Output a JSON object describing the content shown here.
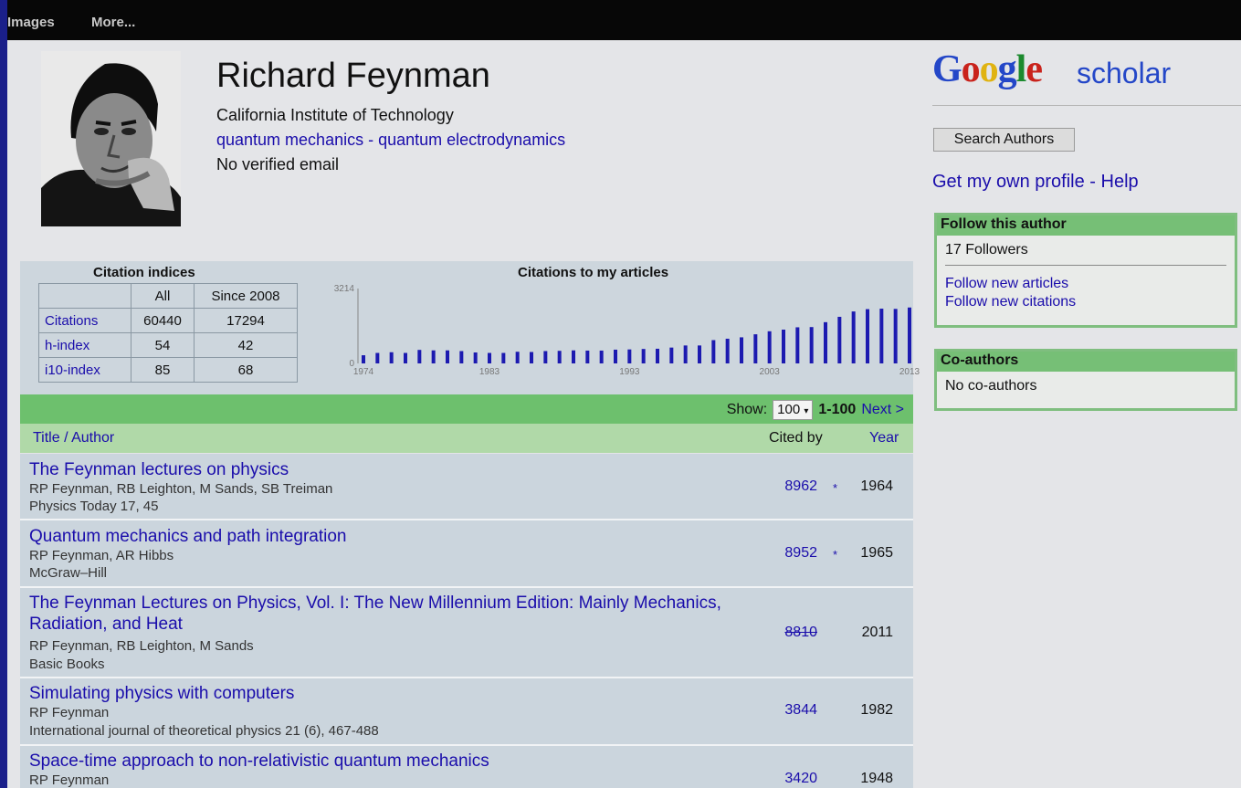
{
  "nav": {
    "images": "Images",
    "more": "More..."
  },
  "profile": {
    "name": "Richard Feynman",
    "institution": "California Institute of Technology",
    "topics": "quantum mechanics - quantum electrodynamics",
    "email": "No verified email"
  },
  "brand": {
    "google": [
      "G",
      "o",
      "o",
      "g",
      "l",
      "e"
    ],
    "scholar": "scholar",
    "colors": [
      "#2447c8",
      "#c9231c",
      "#e0b311",
      "#2447c8",
      "#1c8a2e",
      "#c9231c"
    ]
  },
  "sidebar": {
    "search_button": "Search Authors",
    "profile_link": "Get my own profile - Help",
    "follow_title": "Follow this author",
    "followers": "17 Followers",
    "follow_articles": "Follow new articles",
    "follow_citations": "Follow new citations",
    "coauthors_title": "Co-authors",
    "coauthors_text": "No co-authors"
  },
  "citation_indices": {
    "title": "Citation indices",
    "headers": [
      "",
      "All",
      "Since 2008"
    ],
    "rows": [
      {
        "label": "Citations",
        "all": "60440",
        "since": "17294"
      },
      {
        "label": "h-index",
        "all": "54",
        "since": "42"
      },
      {
        "label": "i10-index",
        "all": "85",
        "since": "68"
      }
    ]
  },
  "chart_data": {
    "type": "bar",
    "title": "Citations to my articles",
    "xlabel": "",
    "ylabel": "",
    "ylim": [
      0,
      3214
    ],
    "y_ticks": [
      "0",
      "3214"
    ],
    "x_ticks": [
      "1974",
      "1983",
      "1993",
      "2003",
      "2013"
    ],
    "color": "#1c1ab0",
    "categories": [
      1974,
      1975,
      1976,
      1977,
      1978,
      1979,
      1980,
      1981,
      1982,
      1983,
      1984,
      1985,
      1986,
      1987,
      1988,
      1989,
      1990,
      1991,
      1992,
      1993,
      1994,
      1995,
      1996,
      1997,
      1998,
      1999,
      2000,
      2001,
      2002,
      2003,
      2004,
      2005,
      2006,
      2007,
      2008,
      2009,
      2010,
      2011,
      2012,
      2013
    ],
    "values": [
      350,
      450,
      480,
      450,
      580,
      560,
      560,
      530,
      470,
      450,
      450,
      500,
      490,
      530,
      540,
      560,
      550,
      550,
      590,
      600,
      620,
      630,
      680,
      770,
      770,
      1000,
      1060,
      1120,
      1250,
      1380,
      1450,
      1550,
      1560,
      1770,
      2000,
      2230,
      2330,
      2350,
      2340,
      2400
    ]
  },
  "articles_bar": {
    "show_label": "Show:",
    "per_page": "100",
    "range": "1-100",
    "next": "Next >"
  },
  "columns": {
    "title": "Title / Author",
    "cited": "Cited by",
    "year": "Year"
  },
  "articles": [
    {
      "title": "The Feynman lectures on physics",
      "authors": "RP Feynman, RB Leighton, M Sands, SB Treiman",
      "venue": "Physics Today 17, 45",
      "cited": "8962",
      "star": "*",
      "year": "1964"
    },
    {
      "title": "Quantum mechanics and path integration",
      "authors": "RP Feynman, AR Hibbs",
      "venue": "McGraw–Hill",
      "cited": "8952",
      "star": "*",
      "year": "1965"
    },
    {
      "title": "The Feynman Lectures on Physics, Vol. I: The New Millennium Edition: Mainly Mechanics, Radiation, and Heat",
      "authors": "RP Feynman, RB Leighton, M Sands",
      "venue": "Basic Books",
      "cited": "8810",
      "star": "",
      "year": "2011"
    },
    {
      "title": "Simulating physics with computers",
      "authors": "RP Feynman",
      "venue": "International journal of theoretical physics 21 (6), 467-488",
      "cited": "3844",
      "star": "",
      "year": "1982"
    },
    {
      "title": "Space-time approach to non-relativistic quantum mechanics",
      "authors": "RP Feynman",
      "venue": "",
      "cited": "3420",
      "star": "",
      "year": "1948"
    }
  ]
}
